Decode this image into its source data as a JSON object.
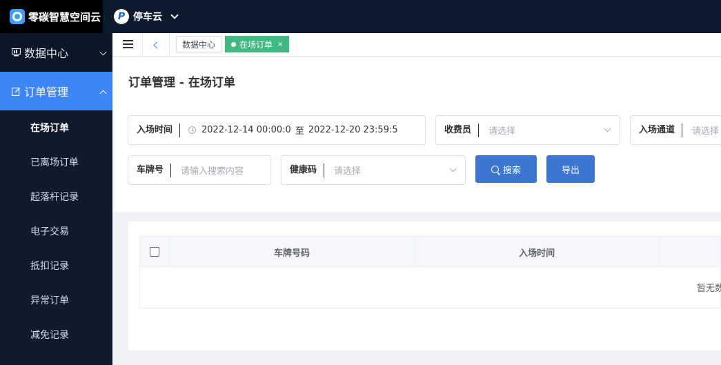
{
  "header": {
    "logo_text": "零碳智慧空间云",
    "product_icon_letter": "P",
    "product_name": "停车云"
  },
  "sidebar": {
    "groups": [
      {
        "label": "数据中心",
        "icon": "monitor-icon",
        "expanded": false,
        "active": false
      },
      {
        "label": "订单管理",
        "icon": "edit-icon",
        "expanded": true,
        "active": true
      }
    ],
    "sub_items": [
      {
        "label": "在场订单",
        "current": true
      },
      {
        "label": "已离场订单"
      },
      {
        "label": "起落杆记录"
      },
      {
        "label": "电子交易"
      },
      {
        "label": "抵扣记录"
      },
      {
        "label": "异常订单"
      },
      {
        "label": "减免记录"
      }
    ]
  },
  "tabs": {
    "home_tag": "数据中心",
    "current_tag": "在场订单",
    "close_symbol": "×"
  },
  "page": {
    "title": "订单管理 - 在场订单"
  },
  "filters": {
    "entry_time": {
      "label": "入场时间",
      "start": "2022-12-14 00:00:0",
      "separator": "至",
      "end": "2022-12-20 23:59:5"
    },
    "cashier": {
      "label": "收费员",
      "placeholder": "请选择"
    },
    "entry_channel": {
      "label": "入场通道",
      "placeholder": "请选择"
    },
    "plate": {
      "label": "车牌号",
      "placeholder": "请输入搜索内容"
    },
    "health_code": {
      "label": "健康码",
      "placeholder": "请选择"
    },
    "search_button": "搜索",
    "export_button": "导出"
  },
  "table": {
    "columns": [
      "车牌号码",
      "入场时间"
    ],
    "empty_text": "暂无数据"
  },
  "colors": {
    "topbar": "#0d1a2d",
    "sidebar": "#0f1a2b",
    "accent": "#3c86f7",
    "button": "#3b76d2",
    "tag_active": "#42b983"
  }
}
